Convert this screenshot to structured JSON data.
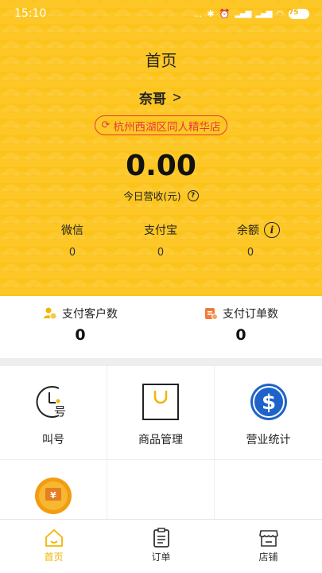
{
  "status_bar": {
    "time": "15:10",
    "dots": "...",
    "battery": "75"
  },
  "header": {
    "title": "首页",
    "user_name": "奈哥",
    "store_name": "杭州西湖区同人精华店",
    "revenue_amount": "0.00",
    "revenue_label": "今日营收(元)"
  },
  "balances": [
    {
      "label": "微信",
      "value": "0"
    },
    {
      "label": "支付宝",
      "value": "0"
    },
    {
      "label": "余额",
      "value": "0"
    }
  ],
  "stats": [
    {
      "label": "支付客户数",
      "value": "0"
    },
    {
      "label": "支付订单数",
      "value": "0"
    }
  ],
  "functions": [
    {
      "label": "叫号",
      "icon": "clock-number-icon"
    },
    {
      "label": "商品管理",
      "icon": "bag-icon"
    },
    {
      "label": "营业统计",
      "icon": "dollar-icon"
    },
    {
      "label": "",
      "icon": "yuan-coin-icon"
    }
  ],
  "bottom_nav": [
    {
      "label": "首页",
      "icon": "home-icon",
      "active": true
    },
    {
      "label": "订单",
      "icon": "orders-icon",
      "active": false
    },
    {
      "label": "店铺",
      "icon": "shop-icon",
      "active": false
    }
  ],
  "colors": {
    "brand_yellow": "#fcc419",
    "accent_red": "#e53935",
    "active_nav": "#f2b500"
  }
}
